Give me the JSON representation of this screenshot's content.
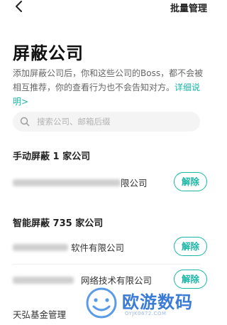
{
  "header": {
    "batch_label": "批量管理"
  },
  "page": {
    "title": "屏蔽公司",
    "description": "添加屏蔽公司后，你和这些公司的Boss，都不会被相互推荐，你的查看行为也不会告知对方。",
    "detail_link": "详细说明>"
  },
  "search": {
    "placeholder": "搜索公司、邮箱后缀"
  },
  "manual": {
    "title": "手动屏蔽 1 家公司",
    "items": [
      {
        "visible_name": "限公司",
        "action": "解除"
      }
    ]
  },
  "smart": {
    "title": "智能屏蔽 735 家公司",
    "items": [
      {
        "visible_name": "软件有限公司",
        "action": "解除"
      },
      {
        "visible_name": "网络技术有限公司",
        "action": "解除"
      },
      {
        "visible_name": "天弘基金管理",
        "action": ""
      }
    ]
  },
  "watermark": {
    "text": "欧游数码",
    "sub": "OYJK0672.COM"
  },
  "colors": {
    "accent": "#19b7a6",
    "watermark": "#3a7bd5"
  }
}
